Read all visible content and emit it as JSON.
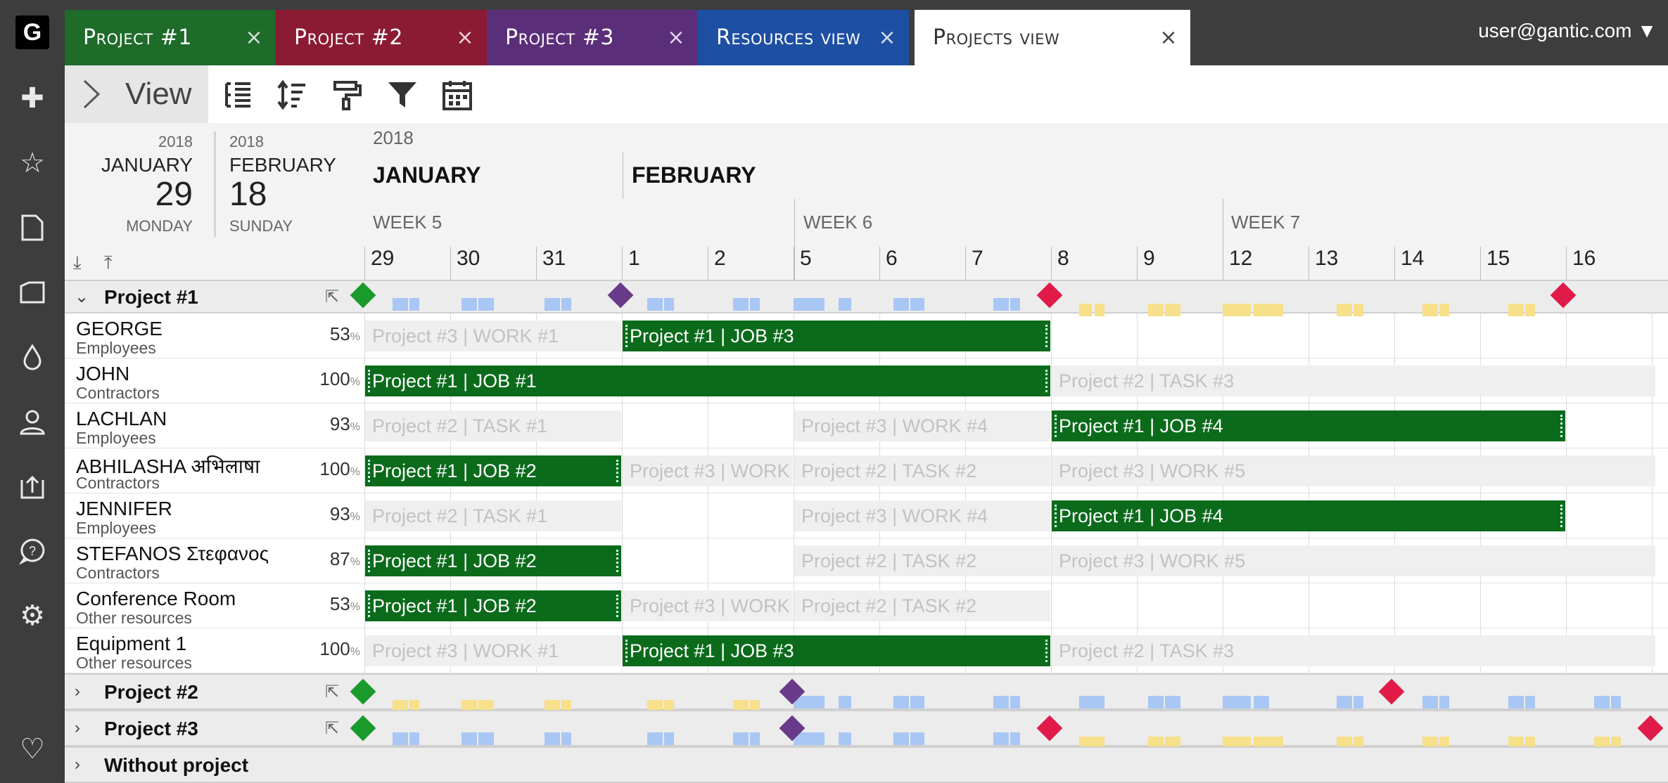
{
  "tabs": [
    {
      "label": "Project #1",
      "color": "#1e6b2a"
    },
    {
      "label": "Project #2",
      "color": "#8b1a33"
    },
    {
      "label": "Project #3",
      "color": "#5b2e7a"
    },
    {
      "label": "Resources view",
      "color": "#1d4fa3"
    },
    {
      "label": "Projects view",
      "color": "#ffffff"
    }
  ],
  "user": "user@gantic.com ▼",
  "toolbar": {
    "view_label": "View"
  },
  "left_header": {
    "start": {
      "year": "2018",
      "month": "JANUARY",
      "day": "29",
      "weekday": "MONDAY"
    },
    "end": {
      "year": "2018",
      "month": "FEBRUARY",
      "day": "18",
      "weekday": "SUNDAY"
    }
  },
  "timeline": {
    "year": "2018",
    "months": [
      "JANUARY",
      "FEBRUARY"
    ],
    "weeks": [
      "WEEK 5",
      "WEEK 6",
      "WEEK 7"
    ],
    "days": [
      "29",
      "30",
      "31",
      "1",
      "2",
      "5",
      "6",
      "7",
      "8",
      "9",
      "12",
      "13",
      "14",
      "15",
      "16"
    ]
  },
  "projects": [
    {
      "name": "Project #1"
    },
    {
      "name": "Project #2"
    },
    {
      "name": "Project #3"
    },
    {
      "name": "Without project"
    }
  ],
  "resources": [
    {
      "name": "GEORGE",
      "group": "Employees",
      "pct": "53"
    },
    {
      "name": "JOHN",
      "group": "Contractors",
      "pct": "100"
    },
    {
      "name": "LACHLAN",
      "group": "Employees",
      "pct": "93"
    },
    {
      "name": "ABHILASHA अभिलाषा",
      "group": "Contractors",
      "pct": "100"
    },
    {
      "name": "JENNIFER",
      "group": "Employees",
      "pct": "93"
    },
    {
      "name": "STEFANOS Στεφανος",
      "group": "Contractors",
      "pct": "87"
    },
    {
      "name": "Conference Room",
      "group": "Other resources",
      "pct": "53"
    },
    {
      "name": "Equipment 1",
      "group": "Other resources",
      "pct": "100"
    }
  ],
  "percent_sign": "%",
  "tasks": {
    "p3_work1": "Project #3 | WORK #1",
    "p1_job3": "Project #1 | JOB #3",
    "p1_job1": "Project #1 | JOB #1",
    "p2_task3": "Project #2 | TASK #3",
    "p2_task1": "Project #2 | TASK #1",
    "p3_work4": "Project #3 | WORK #4",
    "p1_job4": "Project #1 | JOB #4",
    "p1_job2": "Project #1 | JOB #2",
    "p3_work": "Project #3 | WORK",
    "p2_task2": "Project #2 | TASK #2",
    "p3_work5": "Project #3 | WORK #5"
  },
  "colors": {
    "job": "#0b6b1b",
    "milestone_start": "#1a9a2a",
    "milestone_mid": "#6a3a8a",
    "milestone_end": "#e01b4a",
    "load_blue": "#a9c7f5",
    "load_yellow": "#f7e08a"
  }
}
